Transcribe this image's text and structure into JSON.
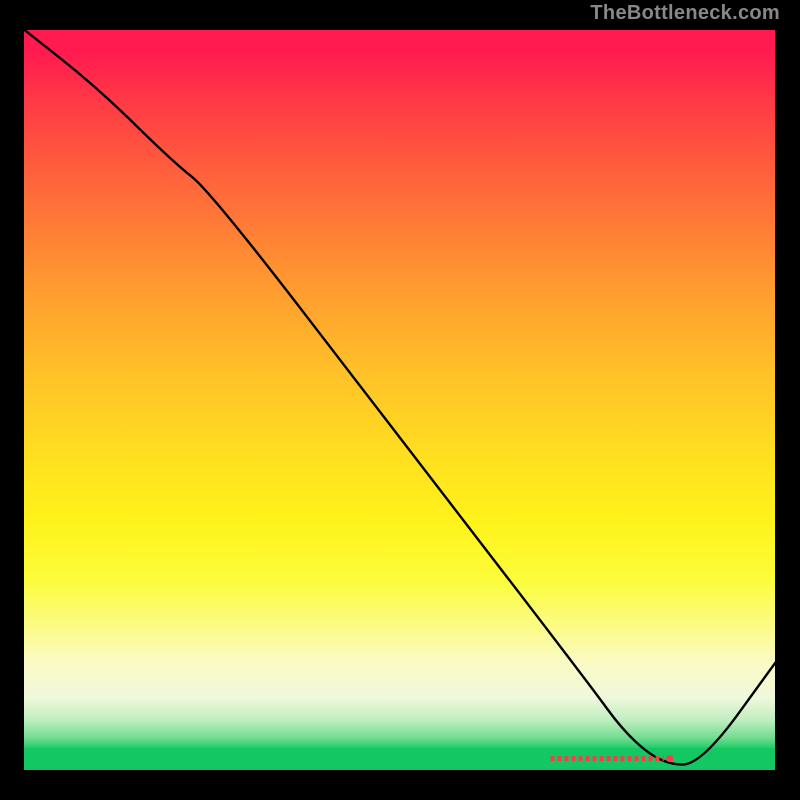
{
  "attribution": "TheBottleneck.com",
  "chart_data": {
    "type": "line",
    "title": "",
    "xlabel": "",
    "ylabel": "",
    "xlim": [
      0,
      100
    ],
    "ylim": [
      0,
      100
    ],
    "series": [
      {
        "name": "curve",
        "x": [
          0,
          10,
          20,
          25,
          50,
          75,
          80,
          85,
          90,
          100
        ],
        "values": [
          100,
          92,
          82,
          78,
          45,
          12,
          5,
          1,
          1,
          15
        ]
      }
    ],
    "marker_band": {
      "x_start": 70,
      "x_end": 85,
      "color": "#ff3a45"
    },
    "gradient_background": true
  },
  "colors": {
    "curve": "#000000",
    "dash": "#ff3a45",
    "attribution": "#888888"
  }
}
